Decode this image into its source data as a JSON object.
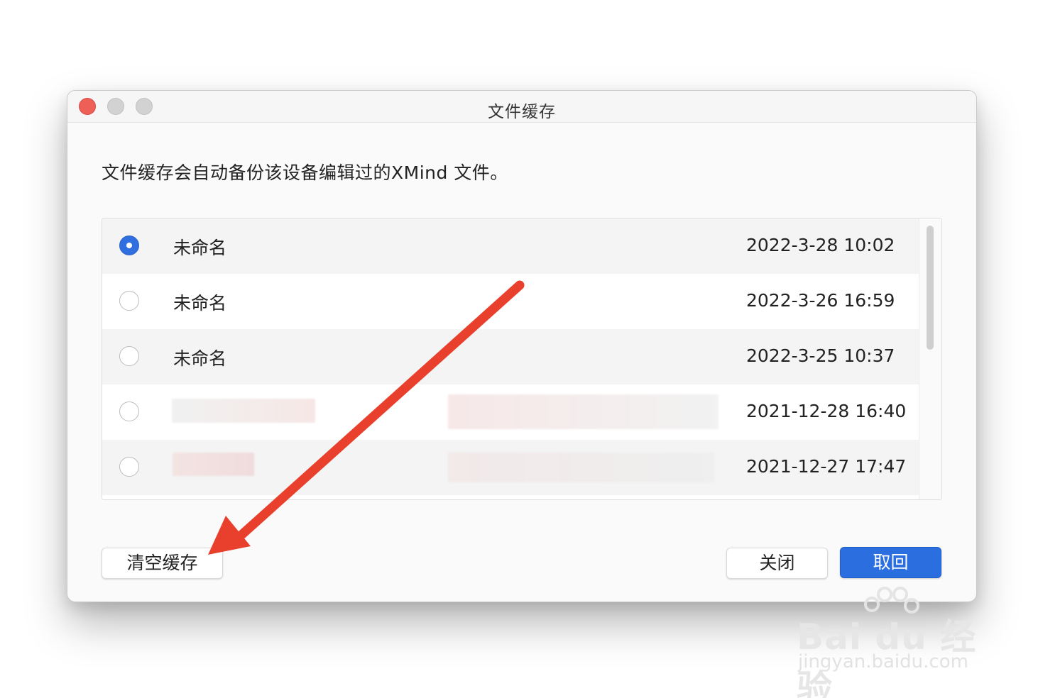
{
  "window": {
    "title": "文件缓存",
    "description": "文件缓存会自动备份该设备编辑过的XMind 文件。"
  },
  "list": {
    "rows": [
      {
        "name": "未命名",
        "date": "2022-3-28 10:02",
        "selected": true
      },
      {
        "name": "未命名",
        "date": "2022-3-26 16:59",
        "selected": false
      },
      {
        "name": "未命名",
        "date": "2022-3-25 10:37",
        "selected": false
      },
      {
        "name": "",
        "date": "2021-12-28 16:40",
        "selected": false
      },
      {
        "name": "",
        "date": "2021-12-27 17:47",
        "selected": false
      }
    ]
  },
  "buttons": {
    "clear_cache": "清空缓存",
    "close": "关闭",
    "retrieve": "取回"
  },
  "colors": {
    "accent": "#2a6ee0",
    "close_dot": "#ee5f57",
    "annotation_arrow": "#e8402c"
  },
  "watermark": {
    "brand": "Bai du 经验",
    "url": "jingyan.baidu.com"
  }
}
